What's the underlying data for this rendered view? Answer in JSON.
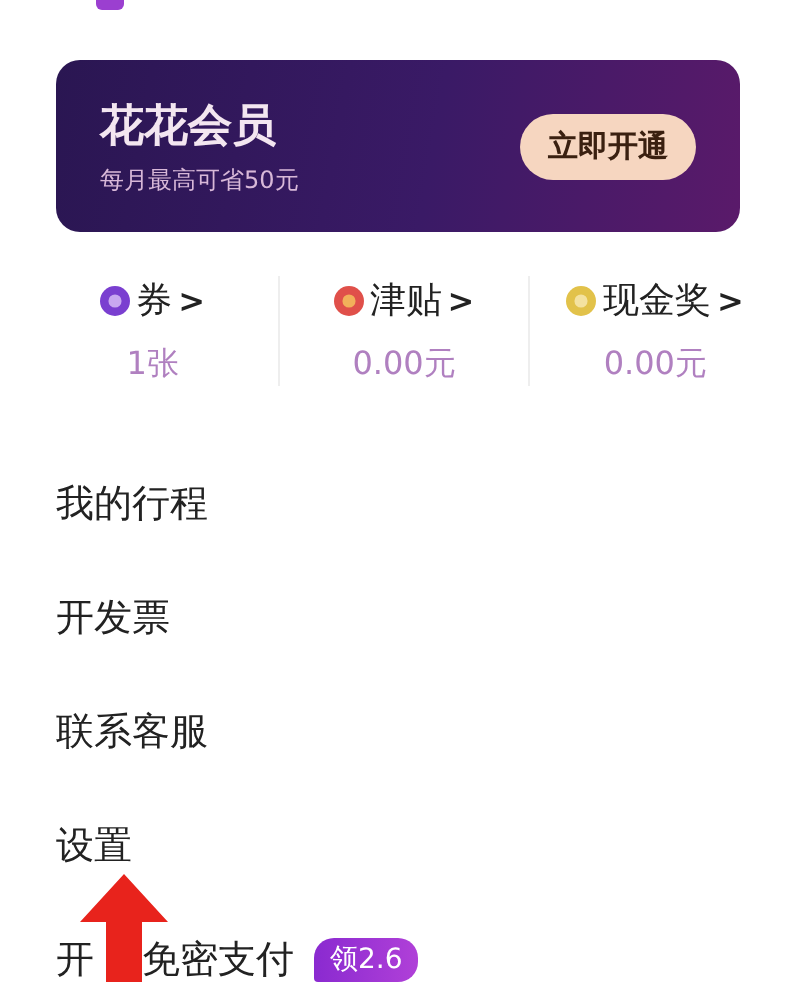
{
  "membership_banner": {
    "title": "花花会员",
    "subtitle": "每月最高可省50元",
    "button": "立即开通"
  },
  "stats": [
    {
      "kind": "coupon",
      "label": "券",
      "arrow": ">",
      "value": "1张"
    },
    {
      "kind": "subsidy",
      "label": "津贴",
      "arrow": ">",
      "value": "0.00元"
    },
    {
      "kind": "cash",
      "label": "现金奖",
      "arrow": ">",
      "value": "0.00元"
    }
  ],
  "menu": [
    {
      "label": "我的行程"
    },
    {
      "label": "开发票"
    },
    {
      "label": "联系客服"
    },
    {
      "label": "设置"
    },
    {
      "segments": [
        "开",
        "免密支付"
      ],
      "badge": "领2.6"
    }
  ]
}
